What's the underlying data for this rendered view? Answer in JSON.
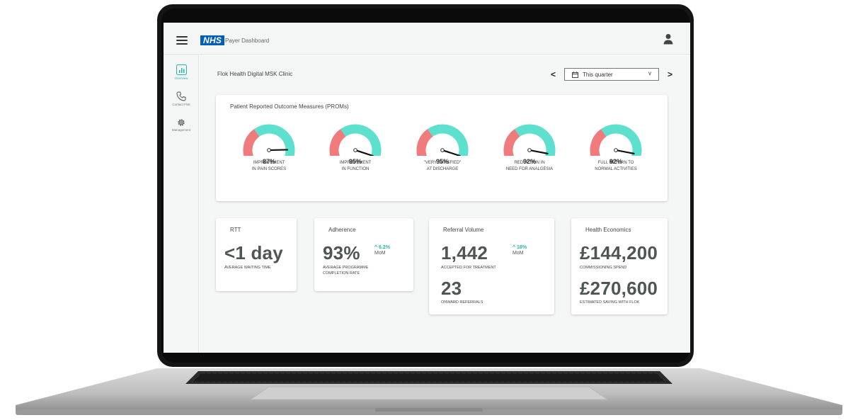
{
  "header": {
    "logo_text": "NHS",
    "app_title": "Payer Dashboard",
    "menu_icon": "hamburger-menu-icon",
    "user_icon": "user-icon"
  },
  "sidebar": {
    "items": [
      {
        "label": "Overview",
        "icon": "bar-chart-icon",
        "active": true
      },
      {
        "label": "Contact Flok",
        "icon": "phone-icon",
        "active": false
      },
      {
        "label": "Management",
        "icon": "gear-icon",
        "active": false
      }
    ]
  },
  "main": {
    "clinic_title": "Flok Health Digital MSK Clinic",
    "period": {
      "prev_label": "<",
      "next_label": ">",
      "selected": "This quarter",
      "chevron": "v"
    }
  },
  "proms": {
    "title": "Patient Reported Outcome Measures (PROMs)",
    "gauges": [
      {
        "value": 87,
        "display": "87%",
        "line1": "IMPROVEMENT",
        "line2": "IN PAIN SCORES"
      },
      {
        "value": 95,
        "display": "95%",
        "line1": "IMPROVEMENT",
        "line2": "IN FUNCTION"
      },
      {
        "value": 95,
        "display": "95%",
        "line1": "\"VERY SATISFIED\"",
        "line2": "AT DISCHARGE"
      },
      {
        "value": 92,
        "display": "92%",
        "line1": "REDUCTION IN",
        "line2": "NEED FOR ANALGESIA"
      },
      {
        "value": 92,
        "display": "92%",
        "line1": "FULL RETURN TO",
        "line2": "NORMAL ACTIVITIES"
      }
    ]
  },
  "rtt": {
    "title": "RTT",
    "value": "<1 day",
    "caption": "AVERAGE WAITING TIME"
  },
  "adherence": {
    "title": "Adherence",
    "value": "93%",
    "delta": "^ 6.2%",
    "delta_label": "MoM",
    "caption1": "AVERAGE PROGRAMME",
    "caption2": "COMPLETION RATE"
  },
  "referral": {
    "title": "Referral Volume",
    "value": "1,442",
    "delta": "^ 18%",
    "delta_label": "MoM",
    "caption": "ACCEPTED FOR TREATMENT",
    "value2": "23",
    "caption2": "ONWARD REFERRALS"
  },
  "economics": {
    "title": "Health Economics",
    "value": "£144,200",
    "caption": "COMMISSIONING SPEND",
    "value2": "£270,600",
    "caption2": "ESTIMATED SAVING WITH FLOK"
  },
  "colors": {
    "accent": "#24b8a8",
    "gauge_red": "#f07b7d",
    "gauge_teal": "#5ee0cf",
    "nhs_blue": "#005eb8",
    "metric_text": "#4e5654"
  }
}
